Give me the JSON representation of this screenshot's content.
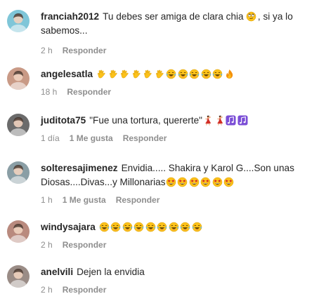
{
  "comments": [
    {
      "username": "franciah2012",
      "text": "Tu debes ser amiga de clara chia",
      "text_after": ", si ya lo sabemos...",
      "emojis_inline": [
        "rolling-eyes-emoji"
      ],
      "time": "2 h",
      "likes": "",
      "reply": "Responder",
      "avatar_color": "#7fc6d8"
    },
    {
      "username": "angelesatla",
      "text": "",
      "emojis": [
        "clapping-hands-emoji",
        "clapping-hands-emoji",
        "clapping-hands-emoji",
        "clapping-hands-emoji",
        "clapping-hands-emoji",
        "clapping-hands-emoji",
        "tears-of-joy-emoji",
        "tears-of-joy-emoji",
        "tears-of-joy-emoji",
        "tears-of-joy-emoji",
        "tears-of-joy-emoji",
        "fire-emoji"
      ],
      "time": "18 h",
      "likes": "",
      "reply": "Responder",
      "avatar_color": "#c99a86"
    },
    {
      "username": "juditota75",
      "text": "\"Fue una tortura, quererte\"",
      "emojis": [
        "dancer-emoji",
        "dancer-emoji",
        "music-notes-emoji",
        "music-notes-emoji"
      ],
      "time": "1 día",
      "likes": "1 Me gusta",
      "reply": "Responder",
      "avatar_color": "#6b6b6b"
    },
    {
      "username": "solteresajimenez",
      "text": "Envidia..... Shakira y Karol G....Son unas Diosas....Divas...y Millonarias",
      "emojis": [
        "star-struck-emoji",
        "star-struck-emoji",
        "star-struck-emoji",
        "star-struck-emoji",
        "star-struck-emoji",
        "star-struck-emoji"
      ],
      "time": "1 h",
      "likes": "1 Me gusta",
      "reply": "Responder",
      "avatar_color": "#8a9ea5"
    },
    {
      "username": "windysajara",
      "text": "",
      "emojis": [
        "tears-of-joy-emoji",
        "tears-of-joy-emoji",
        "tears-of-joy-emoji",
        "tears-of-joy-emoji",
        "tears-of-joy-emoji",
        "tears-of-joy-emoji",
        "tears-of-joy-emoji",
        "tears-of-joy-emoji",
        "tears-of-joy-emoji"
      ],
      "time": "2 h",
      "likes": "",
      "reply": "Responder",
      "avatar_color": "#b98a7e"
    },
    {
      "username": "anelvili",
      "text": "Dejen la envidia",
      "emojis": [],
      "time": "2 h",
      "likes": "",
      "reply": "Responder",
      "avatar_color": "#9a8c86"
    }
  ],
  "colors": {
    "text": "#262626",
    "meta": "#8e8e8e",
    "emoji_yellow": "#fcc21b",
    "emoji_red": "#d22f27",
    "emoji_purple": "#7b4ed6"
  }
}
